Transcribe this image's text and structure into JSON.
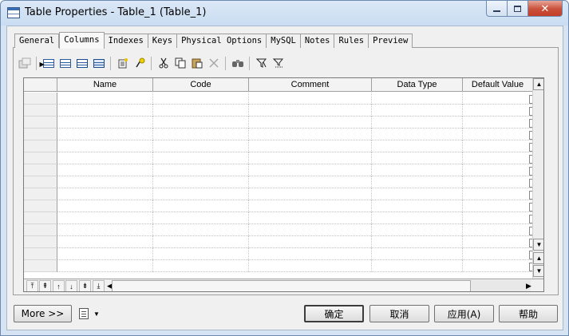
{
  "window": {
    "title": "Table Properties - Table_1 (Table_1)",
    "controls": {
      "close": "✕"
    }
  },
  "tabs": [
    {
      "label": "General",
      "active": false
    },
    {
      "label": "Columns",
      "active": true
    },
    {
      "label": "Indexes",
      "active": false
    },
    {
      "label": "Keys",
      "active": false
    },
    {
      "label": "Physical Options",
      "active": false
    },
    {
      "label": "MySQL",
      "active": false
    },
    {
      "label": "Notes",
      "active": false
    },
    {
      "label": "Rules",
      "active": false
    },
    {
      "label": "Preview",
      "active": false
    }
  ],
  "toolbar": {
    "icons": [
      "properties-icon",
      "insert-row-icon",
      "add-row-icon",
      "add-rows-icon",
      "insert-rows-icon",
      "add-columns-icon",
      "create-attribute-icon",
      "cut-icon",
      "copy-icon",
      "paste-icon",
      "delete-icon",
      "find-icon",
      "filter-icon",
      "clear-filter-icon"
    ]
  },
  "grid": {
    "columns": [
      "Name",
      "Code",
      "Comment",
      "Data Type",
      "Default Value"
    ],
    "row_count": 15
  },
  "nav": {
    "icons": [
      "move-top-icon",
      "move-page-up-icon",
      "move-up-icon",
      "move-down-icon",
      "move-page-down-icon",
      "move-bottom-icon",
      "scroll-left-icon"
    ]
  },
  "footer": {
    "more_label": "More >>",
    "ok_label": "确定",
    "cancel_label": "取消",
    "apply_label": "应用(A)",
    "help_label": "帮助"
  }
}
